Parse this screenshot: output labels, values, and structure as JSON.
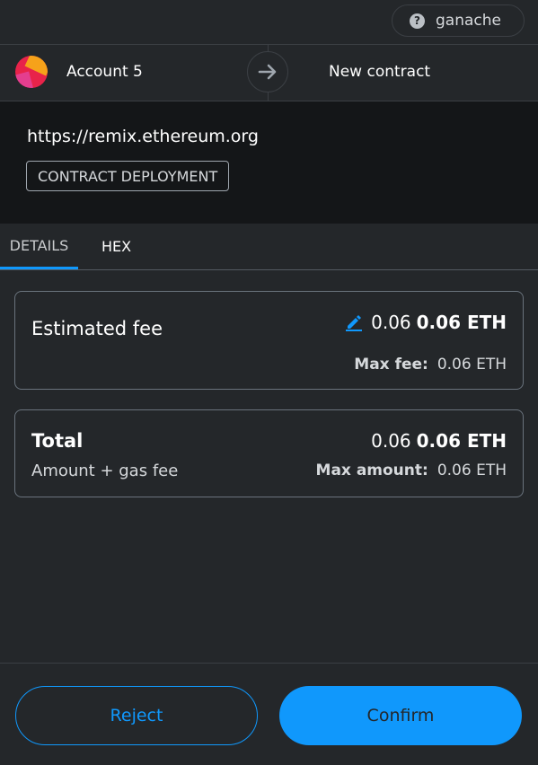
{
  "network": {
    "label": "ganache",
    "icon": "question-icon"
  },
  "header": {
    "account_name": "Account 5",
    "recipient": "New contract"
  },
  "origin": {
    "url": "https://remix.ethereum.org",
    "type_badge": "CONTRACT DEPLOYMENT"
  },
  "tabs": [
    {
      "label": "DETAILS",
      "active": true
    },
    {
      "label": "HEX",
      "active": false
    }
  ],
  "fee": {
    "label": "Estimated fee",
    "value": "0.06",
    "value_bold": "0.06 ETH",
    "max_label": "Max fee:",
    "max_value": "0.06 ETH"
  },
  "total": {
    "label": "Total",
    "sub_label": "Amount + gas fee",
    "value": "0.06",
    "value_bold": "0.06 ETH",
    "max_label": "Max amount:",
    "max_value": "0.06 ETH"
  },
  "footer": {
    "reject_label": "Reject",
    "confirm_label": "Confirm"
  },
  "colors": {
    "background": "#24272a",
    "accent": "#1098fc",
    "origin_background": "#141618"
  }
}
